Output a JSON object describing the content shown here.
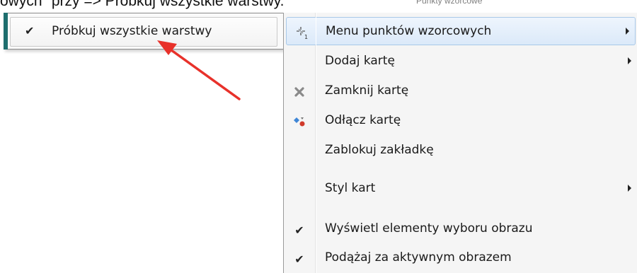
{
  "caption": {
    "text": "owych\" przy => Próbkuj wszystkie warstwy.",
    "ghost": "Punkty wzorcowe"
  },
  "submenu": {
    "item_label": "Próbkuj wszystkie warstwy",
    "item_checked": true
  },
  "menu": {
    "items": [
      {
        "label": "Menu punktów wzorcowych",
        "icon": "sample-points-icon",
        "has_submenu": true,
        "highlighted": true
      },
      {
        "label": "Dodaj kartę",
        "icon": "",
        "has_submenu": true
      },
      {
        "label": "Zamknij kartę",
        "icon": "close-x-icon",
        "has_submenu": false
      },
      {
        "label": "Odłącz kartę",
        "icon": "detach-tab-icon",
        "has_submenu": false
      },
      {
        "label": "Zablokuj zakładkę",
        "icon": "",
        "has_submenu": false
      },
      {
        "label": "Styl kart",
        "icon": "",
        "has_submenu": true
      },
      {
        "label": "Wyświetl elementy wyboru obrazu",
        "icon": "check-icon",
        "checked": true,
        "has_submenu": false
      },
      {
        "label": "Podążaj za aktywnym obrazem",
        "icon": "check-icon",
        "checked": true,
        "has_submenu": false
      }
    ]
  },
  "colors": {
    "annotation_arrow": "#e8312a",
    "submenu_accent": "#1e6e6e",
    "highlight_border": "#a8c8e8"
  }
}
